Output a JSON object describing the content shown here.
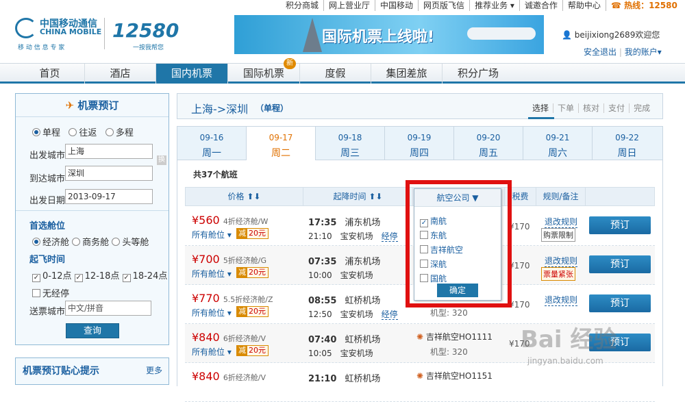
{
  "toplinks": [
    "积分商城",
    "网上营业厅",
    "中国移动",
    "网页版飞信",
    "推荐业务 ▾",
    "诚邀合作",
    "帮助中心"
  ],
  "hotline": "热线：12580",
  "logo": {
    "cn": "中国移动通信",
    "en": "CHINA MOBILE",
    "slogan": "移 动 信 息 专 家",
    "brand": "12580",
    "brand_sub": "一按我帮您"
  },
  "banner": {
    "text": "国际机票上线啦!"
  },
  "user": {
    "name": "beijixiong2689欢迎您",
    "logout": "安全退出",
    "account": "我的账户▾"
  },
  "nav": [
    "首页",
    "酒店",
    "国内机票",
    "国际机票",
    "度假",
    "集团差旅",
    "积分广场"
  ],
  "nav_badge": "新",
  "left": {
    "title": "机票预订",
    "trip_types": [
      "单程",
      "往返",
      "多程"
    ],
    "from_label": "出发城市",
    "from_value": "上海",
    "to_label": "到达城市",
    "to_value": "深圳",
    "swap": "换",
    "date_label": "出发日期",
    "date_value": "2013-09-17",
    "cabin_title": "首选舱位",
    "cabins": [
      "经济舱",
      "商务舱",
      "头等舱"
    ],
    "time_title": "起飞时间",
    "times": [
      "0-12点",
      "12-18点",
      "18-24点",
      "无经停"
    ],
    "delivery_label": "送票城市",
    "delivery_placeholder": "中文/拼音",
    "search": "查询",
    "tips_title": "机票预订贴心提示",
    "tips_more": "更多"
  },
  "route": {
    "text": "上海->深圳",
    "type": "（单程）"
  },
  "steps": [
    "选择",
    "下单",
    "核对",
    "支付",
    "完成"
  ],
  "dates": [
    {
      "d": "09-16",
      "w": "周一"
    },
    {
      "d": "09-17",
      "w": "周二"
    },
    {
      "d": "09-18",
      "w": "周三"
    },
    {
      "d": "09-19",
      "w": "周四"
    },
    {
      "d": "09-20",
      "w": "周五"
    },
    {
      "d": "09-21",
      "w": "周六"
    },
    {
      "d": "09-22",
      "w": "周日"
    }
  ],
  "count": "共37个航班",
  "headers": {
    "price": "价格 ⬆⬇",
    "time": "起降时间 ⬆⬇",
    "airline": "航空公司 ▼",
    "tax": "税费",
    "rule": "规则/备注"
  },
  "flights": [
    {
      "price": "¥560",
      "class": "4折经济舱/W",
      "cabin": "所有舱位 ▾",
      "disc": "20元",
      "dep_time": "17:35",
      "dep_ap": "浦东机场",
      "arr_time": "21:10",
      "arr_ap": "宝安机场",
      "stop": "经停",
      "airline": "",
      "model": "",
      "tax": "¥170",
      "rule": "退改规则",
      "tag": "购票限制",
      "book": "预订"
    },
    {
      "price": "¥700",
      "class": "5折经济舱/G",
      "cabin": "所有舱位 ▾",
      "disc": "20元",
      "dep_time": "07:35",
      "dep_ap": "浦东机场",
      "arr_time": "10:00",
      "arr_ap": "宝安机场",
      "stop": "",
      "airline": "",
      "model": "",
      "tax": "¥170",
      "rule": "退改规则",
      "tag": "票量紧张",
      "book": "预订"
    },
    {
      "price": "¥770",
      "class": "5.5折经济舱/Z",
      "cabin": "所有舱位 ▾",
      "disc": "20元",
      "dep_time": "08:55",
      "dep_ap": "虹桥机场",
      "arr_time": "12:50",
      "arr_ap": "宝安机场",
      "stop": "经停",
      "airline": "",
      "model": "机型: 320",
      "tax": "¥170",
      "rule": "退改规则",
      "tag": "",
      "book": "预订"
    },
    {
      "price": "¥840",
      "class": "6折经济舱/V",
      "cabin": "所有舱位 ▾",
      "disc": "20元",
      "dep_time": "07:40",
      "dep_ap": "虹桥机场",
      "arr_time": "10:05",
      "arr_ap": "宝安机场",
      "stop": "",
      "airline": "吉祥航空HO1111",
      "model": "机型: 320",
      "tax": "¥170",
      "rule": "",
      "tag": "",
      "book": "预订"
    },
    {
      "price": "¥840",
      "class": "6折经济舱/V",
      "cabin": "",
      "disc": "",
      "dep_time": "21:10",
      "dep_ap": "虹桥机场",
      "arr_time": "",
      "arr_ap": "",
      "stop": "",
      "airline": "吉祥航空HO1151",
      "model": "",
      "tax": "",
      "rule": "",
      "tag": "",
      "book": ""
    }
  ],
  "popup": {
    "items": [
      "南航",
      "东航",
      "吉祥航空",
      "深航",
      "国航"
    ],
    "checked": [
      true,
      false,
      false,
      false,
      false
    ],
    "ok": "确定"
  },
  "watermark": {
    "text": "Bai 经验",
    "sub": "jingyan.baidu.com"
  },
  "colors": {
    "accent": "#1f76a8",
    "price": "#cc0000",
    "highlight": "#e01010",
    "orange": "#e07000"
  }
}
